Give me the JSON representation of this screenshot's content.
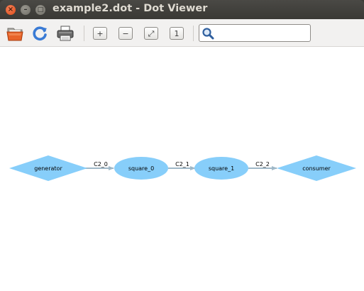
{
  "window": {
    "title": "example2.dot - Dot Viewer",
    "close_glyph": "×",
    "minimize_glyph": "–",
    "maximize_glyph": "□"
  },
  "toolbar": {
    "open_icon": "folder-open-icon",
    "reload_icon": "reload-icon",
    "print_icon": "printer-icon",
    "zoom_in_glyph": "+",
    "zoom_out_glyph": "−",
    "zoom_fit_glyph": "⤢",
    "zoom_100_glyph": "1",
    "search_icon": "magnifier-icon"
  },
  "search": {
    "value": "",
    "placeholder": ""
  },
  "graph": {
    "node_color": "#87cefa",
    "edge_color": "#9fb8c8",
    "nodes": [
      {
        "id": "generator",
        "label": "generator",
        "shape": "diamond"
      },
      {
        "id": "square_0",
        "label": "square_0",
        "shape": "ellipse"
      },
      {
        "id": "square_1",
        "label": "square_1",
        "shape": "ellipse"
      },
      {
        "id": "consumer",
        "label": "consumer",
        "shape": "diamond"
      }
    ],
    "edges": [
      {
        "from": "generator",
        "to": "square_0",
        "label": "C2_0"
      },
      {
        "from": "square_0",
        "to": "square_1",
        "label": "C2_1"
      },
      {
        "from": "square_1",
        "to": "consumer",
        "label": "C2_2"
      }
    ]
  }
}
